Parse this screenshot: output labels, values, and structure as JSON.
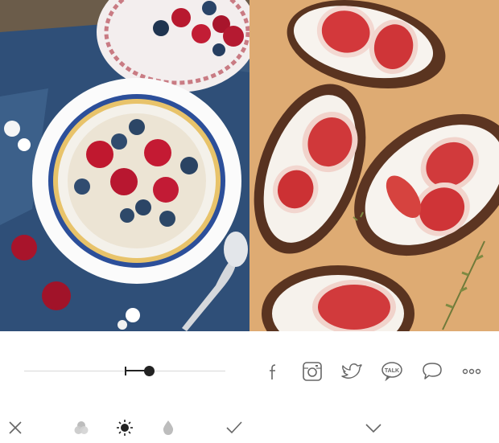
{
  "photos": [
    {
      "name": "oatmeal-porridge-photo"
    },
    {
      "name": "fig-toasts-photo"
    }
  ],
  "adjustment": {
    "level": 0.62
  },
  "share": {
    "icons": [
      "facebook-icon",
      "instagram-icon",
      "twitter-icon",
      "kakaotalk-icon",
      "message-icon",
      "more-icon"
    ],
    "kakao_label": "TALK"
  },
  "toolbar": {
    "icons": [
      "close-icon",
      "tint-icon",
      "brightness-icon",
      "drop-icon",
      "checkmark-icon",
      "chevron-down-icon"
    ]
  },
  "colors": {
    "icon": "#666666",
    "icon_light": "#bdbdbd",
    "slider_active": "#222222",
    "slider_track": "#d8d8d8"
  }
}
